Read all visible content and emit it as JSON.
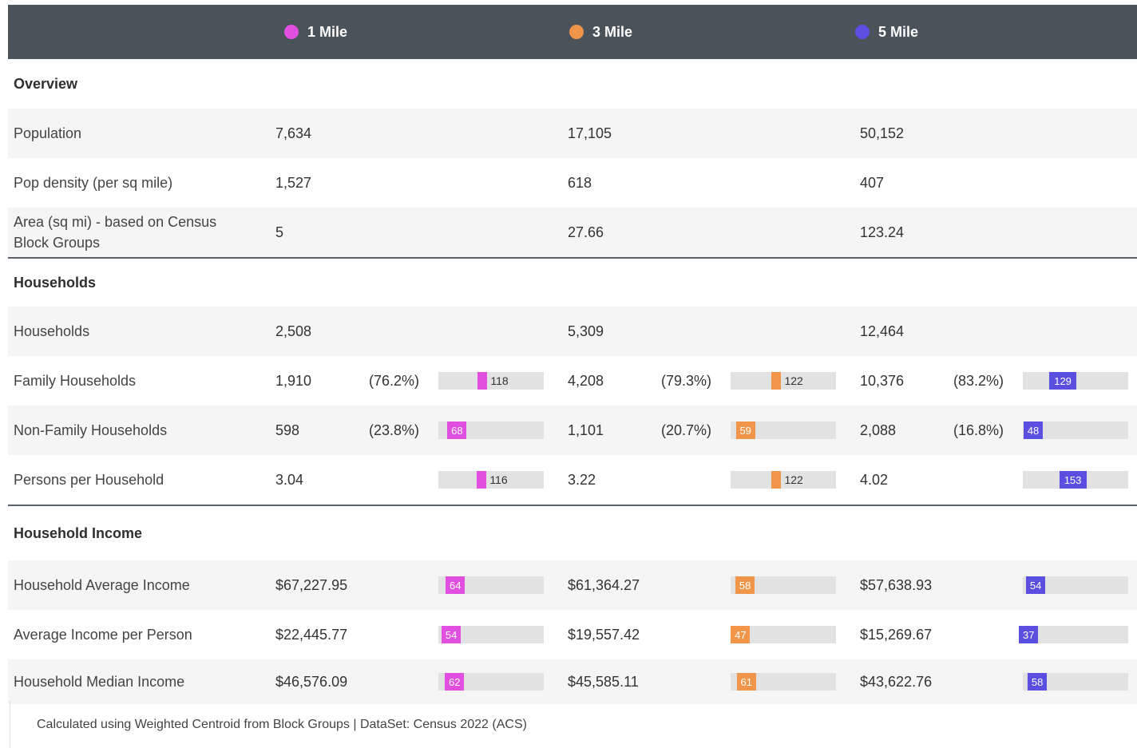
{
  "header": {
    "columns": [
      {
        "label": "1 Mile",
        "color": "#e04fe0"
      },
      {
        "label": "3 Mile",
        "color": "#f0954a"
      },
      {
        "label": "5 Mile",
        "color": "#5a4fe0"
      }
    ]
  },
  "sections": {
    "overview": "Overview",
    "households": "Households",
    "household_income": "Household Income"
  },
  "rows": {
    "population": {
      "label": "Population",
      "v": [
        "7,634",
        "17,105",
        "50,152"
      ]
    },
    "pop_density": {
      "label": "Pop density (per sq mile)",
      "v": [
        "1,527",
        "618",
        "407"
      ]
    },
    "area": {
      "label": "Area (sq mi) - based on Census Block Groups",
      "v": [
        "5",
        "27.66",
        "123.24"
      ]
    },
    "households": {
      "label": "Households",
      "v": [
        "2,508",
        "5,309",
        "12,464"
      ]
    },
    "family_households": {
      "label": "Family Households",
      "v": [
        "1,910",
        "4,208",
        "10,376"
      ],
      "pct": [
        "(76.2%)",
        "(79.3%)",
        "(83.2%)"
      ],
      "idx": [
        "118",
        "122",
        "129"
      ]
    },
    "nonfamily_households": {
      "label": "Non-Family Households",
      "v": [
        "598",
        "1,101",
        "2,088"
      ],
      "pct": [
        "(23.8%)",
        "(20.7%)",
        "(16.8%)"
      ],
      "idx": [
        "68",
        "59",
        "48"
      ]
    },
    "persons_per_household": {
      "label": "Persons per Household",
      "v": [
        "3.04",
        "3.22",
        "4.02"
      ],
      "idx": [
        "116",
        "122",
        "153"
      ]
    },
    "avg_income": {
      "label": "Household Average Income",
      "v": [
        "$67,227.95",
        "$61,364.27",
        "$57,638.93"
      ],
      "idx": [
        "64",
        "58",
        "54"
      ]
    },
    "income_per_person": {
      "label": "Average Income per Person",
      "v": [
        "$22,445.77",
        "$19,557.42",
        "$15,269.67"
      ],
      "idx": [
        "54",
        "47",
        "37"
      ]
    },
    "median_income": {
      "label": "Household Median Income",
      "v": [
        "$46,576.09",
        "$45,585.11",
        "$43,622.76"
      ],
      "idx": [
        "62",
        "61",
        "58"
      ]
    }
  },
  "footer": "Calculated using Weighted Centroid from Block Groups | DataSet: Census 2022 (ACS)"
}
